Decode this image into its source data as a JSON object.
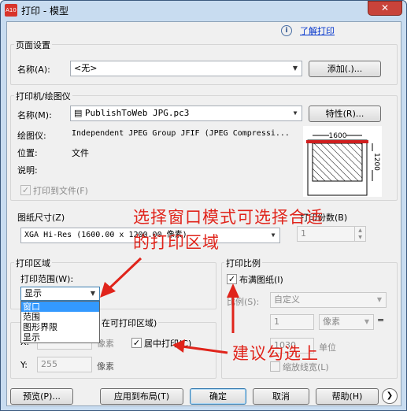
{
  "window": {
    "title": "打印 - 模型",
    "app_icon_text": "A10",
    "close_glyph": "✕"
  },
  "help": {
    "link_label": "了解打印",
    "icon_glyph": "i"
  },
  "page_setup": {
    "group_label": "页面设置",
    "name_label": "名称(A):",
    "name_value": "<无>",
    "add_button": "添加(.)..."
  },
  "printer": {
    "group_label": "打印机/绘图仪",
    "name_label": "名称(M):",
    "name_value": "PublishToWeb JPG.pc3",
    "properties_button": "特性(R)...",
    "plotter_label": "绘图仪:",
    "plotter_value": "Independent JPEG Group JFIF (JPEG Compressi...",
    "location_label": "位置:",
    "location_value": "文件",
    "description_label": "说明:",
    "print_to_file_label": "打印到文件(F)",
    "print_to_file_checked": true,
    "preview_width_label": "1600",
    "preview_height_label": "1200"
  },
  "paper_size": {
    "group_label": "图纸尺寸(Z)",
    "value": "XGA Hi-Res (1600.00 x 1200.00 像素)"
  },
  "copies": {
    "label": "打印份数(B)",
    "value": "1"
  },
  "print_area": {
    "group_label": "打印区域",
    "range_label": "打印范围(W):",
    "range_value": "显示",
    "options": [
      "窗口",
      "范围",
      "图形界限",
      "显示"
    ],
    "selected_option": "窗口"
  },
  "print_offset": {
    "group_label_partial": "在可打印区域)",
    "x_label": "X:",
    "x_unit": "像素",
    "y_label": "Y:",
    "y_value": "255",
    "y_unit": "像素",
    "center_label": "居中打印(C)",
    "center_checked": true
  },
  "print_scale": {
    "group_label": "打印比例",
    "fit_label": "布满图纸(I)",
    "fit_checked": true,
    "scale_label": "比例(S):",
    "scale_value": "自定义",
    "value1": "1",
    "unit_value": "像素",
    "equals": "=",
    "value2": "1030",
    "unit_label": "单位",
    "lineweight_label": "缩放线宽(L)"
  },
  "footer": {
    "preview_button": "预览(P)...",
    "apply_button": "应用到布局(T)",
    "ok_button": "确定",
    "cancel_button": "取消",
    "help_button": "帮助(H)",
    "expand_glyph": "❯"
  },
  "annotations": {
    "line1": "选择窗口模式可选择合适",
    "line2": "的打印区域",
    "line3": "建议勾选上",
    "color": "#e0241b"
  }
}
